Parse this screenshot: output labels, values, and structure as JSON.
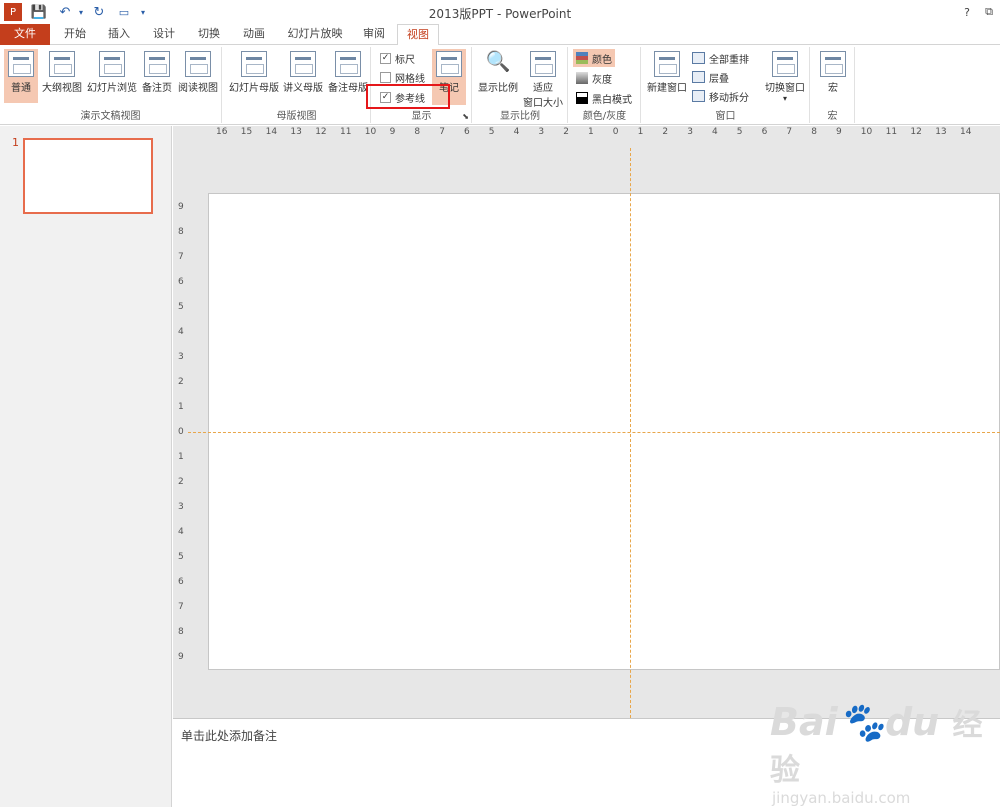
{
  "titlebar": {
    "title": "2013版PPT - PowerPoint",
    "help": "?",
    "restore": "⧉"
  },
  "tabs": [
    {
      "label": "文件"
    },
    {
      "label": "开始"
    },
    {
      "label": "插入"
    },
    {
      "label": "设计"
    },
    {
      "label": "切换"
    },
    {
      "label": "动画"
    },
    {
      "label": "幻灯片放映"
    },
    {
      "label": "审阅"
    },
    {
      "label": "视图"
    }
  ],
  "ribbon": {
    "presentation_views": {
      "label": "演示文稿视图",
      "buttons": [
        "普通",
        "大纲视图",
        "幻灯片浏览",
        "备注页",
        "阅读视图"
      ]
    },
    "master_views": {
      "label": "母版视图",
      "buttons": [
        "幻灯片母版",
        "讲义母版",
        "备注母版"
      ]
    },
    "show": {
      "label": "显示",
      "ruler": "标尺",
      "gridlines": "网格线",
      "guides": "参考线",
      "notes": "笔记",
      "ruler_checked": true,
      "gridlines_checked": false,
      "guides_checked": true
    },
    "zoom": {
      "label": "显示比例",
      "zoom_btn": "显示比例",
      "fit_line1": "适应",
      "fit_line2": "窗口大小"
    },
    "color": {
      "label": "颜色/灰度",
      "color": "颜色",
      "gray": "灰度",
      "bw": "黑白模式"
    },
    "window": {
      "label": "窗口",
      "new": "新建窗口",
      "arrange": "全部重排",
      "cascade": "层叠",
      "split": "移动拆分",
      "switch": "切换窗口"
    },
    "macro": {
      "label": "宏",
      "macro": "宏"
    }
  },
  "rulers": {
    "h_ticks": [
      "16",
      "15",
      "14",
      "13",
      "12",
      "11",
      "10",
      "9",
      "8",
      "7",
      "6",
      "5",
      "4",
      "3",
      "2",
      "1",
      "0",
      "1",
      "2",
      "3",
      "4",
      "5",
      "6",
      "7",
      "8",
      "9",
      "10",
      "11",
      "12",
      "13",
      "14"
    ],
    "v_ticks": [
      "9",
      "8",
      "7",
      "6",
      "5",
      "4",
      "3",
      "2",
      "1",
      "0",
      "1",
      "2",
      "3",
      "4",
      "5",
      "6",
      "7",
      "8",
      "9"
    ]
  },
  "thumbnails": [
    {
      "number": "1"
    }
  ],
  "notes": {
    "placeholder": "单击此处添加备注"
  },
  "watermark": {
    "brand": "Bai",
    "brand2": "du",
    "brand3": "经验",
    "url": "jingyan.baidu.com"
  },
  "colors": {
    "accent": "#c43e1c",
    "highlight": "#e5171a",
    "guide": "#e8a64a"
  }
}
